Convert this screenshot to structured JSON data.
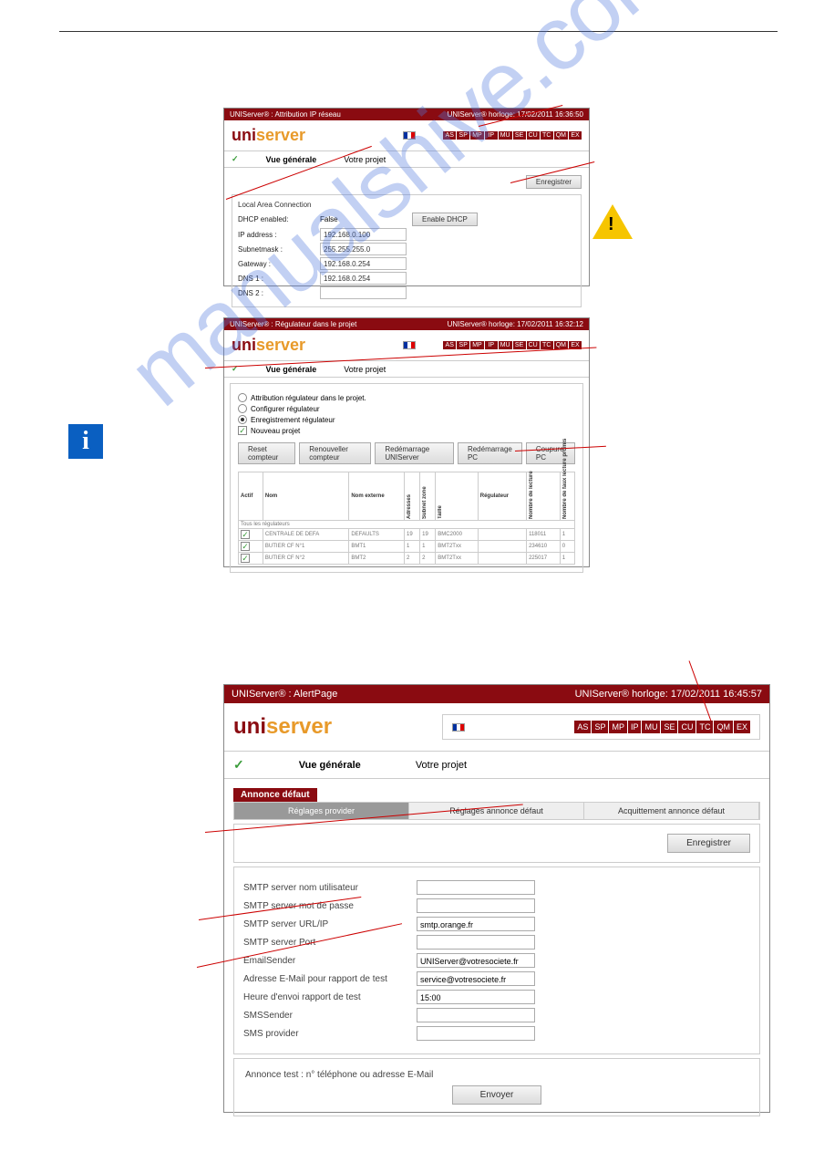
{
  "watermark": "manualshive.com",
  "navbuttons": [
    "AS",
    "SP",
    "MP",
    "IP",
    "MU",
    "SE",
    "CU",
    "TC",
    "QM",
    "EX"
  ],
  "logo": {
    "part1": "uni",
    "part2": "server"
  },
  "common": {
    "vuegenerale": "Vue générale",
    "votreprojet": "Votre projet"
  },
  "screenshot1": {
    "title_left": "UNIServer® : Attribution IP réseau",
    "title_right": "UNIServer® horloge: 17/02/2011 16:36:50",
    "save": "Enregistrer",
    "section": "Local Area Connection",
    "enable_dhcp": "Enable DHCP",
    "fields": {
      "dhcp_lbl": "DHCP enabled:",
      "dhcp_val": "False",
      "ip_lbl": "IP address :",
      "ip_val": "192.168.0.100",
      "mask_lbl": "Subnetmask :",
      "mask_val": "255.255.255.0",
      "gw_lbl": "Gateway :",
      "gw_val": "192.168.0.254",
      "dns1_lbl": "DNS 1 :",
      "dns1_val": "192.168.0.254",
      "dns2_lbl": "DNS 2 :",
      "dns2_val": ""
    }
  },
  "screenshot2": {
    "title_left": "UNIServer® : Régulateur dans le projet",
    "title_right": "UNIServer® horloge: 17/02/2011 16:32:12",
    "options": {
      "attr": "Attribution régulateur dans le projet.",
      "conf": "Configurer régulateur",
      "enreg": "Enregistrement régulateur",
      "nouv": "Nouveau projet"
    },
    "buttons": {
      "reset": "Reset compteur",
      "renew": "Renouveller compteur",
      "redem_uni": "Redémarrage UNIServer",
      "redem_pc": "Redémarrage PC",
      "coupure": "Coupure PC"
    },
    "table": {
      "headers": {
        "actif": "Actif",
        "nom": "Nom",
        "nom_ext": "Nom externe",
        "addr": "Adresses",
        "sub": "Subnet zone",
        "taille": "Taille",
        "reg": "Régulateur",
        "lecture": "Nombre de lecture",
        "faux": "Nombre de faux lecture promis"
      },
      "row0": "Tous les régulateurs",
      "rows": [
        [
          "CENTRALE DE DEFA",
          "DEFAULTS",
          "19",
          "19",
          "BMC2000",
          "",
          "118011",
          "1"
        ],
        [
          "BUTIER CF N°1",
          "BMT1",
          "1",
          "1",
          "BMT2Txx",
          "",
          "234610",
          "0"
        ],
        [
          "BUTIER CF N°2",
          "BMT2",
          "2",
          "2",
          "BMT2Txx",
          "",
          "225017",
          "1"
        ]
      ]
    }
  },
  "screenshot3": {
    "title_left": "UNIServer® : AlertPage",
    "title_right": "UNIServer® horloge: 17/02/2011 16:45:57",
    "annonce": "Annonce défaut",
    "tabs": {
      "provider": "Réglages provider",
      "annonce": "Réglages annonce défaut",
      "acquit": "Acquittement annonce défaut"
    },
    "save": "Enregistrer",
    "fields": {
      "smtp_user_lbl": "SMTP server nom utilisateur",
      "smtp_pass_lbl": "SMTP server mot de passe",
      "smtp_url_lbl": "SMTP server URL/IP",
      "smtp_url_val": "smtp.orange.fr",
      "smtp_port_lbl": "SMTP server Port",
      "emailsender_lbl": "EmailSender",
      "emailsender_val": "UNIServer@votresociete.fr",
      "test_addr_lbl": "Adresse E-Mail pour rapport de test",
      "test_addr_val": "service@votresociete.fr",
      "heure_lbl": "Heure d'envoi rapport de test",
      "heure_val": "15:00",
      "smssender_lbl": "SMSSender",
      "smsprov_lbl": "SMS provider"
    },
    "test_label": "Annonce test : n° téléphone ou adresse E-Mail",
    "envoyer": "Envoyer"
  }
}
